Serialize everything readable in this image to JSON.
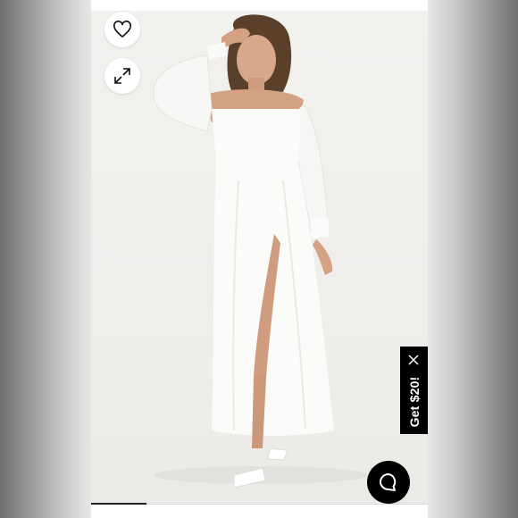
{
  "product": {
    "image_alt": "",
    "colors": {
      "background": "#efeeeb",
      "dress": "#fbfbf9"
    }
  },
  "actions": {
    "favorite_icon": "heart-icon",
    "expand_icon": "expand-arrows-icon"
  },
  "promo": {
    "label": "Get $20!",
    "close_icon": "close-icon"
  },
  "chat": {
    "icon": "chat-bubble-icon"
  },
  "carousel": {
    "current_slide": 1
  }
}
